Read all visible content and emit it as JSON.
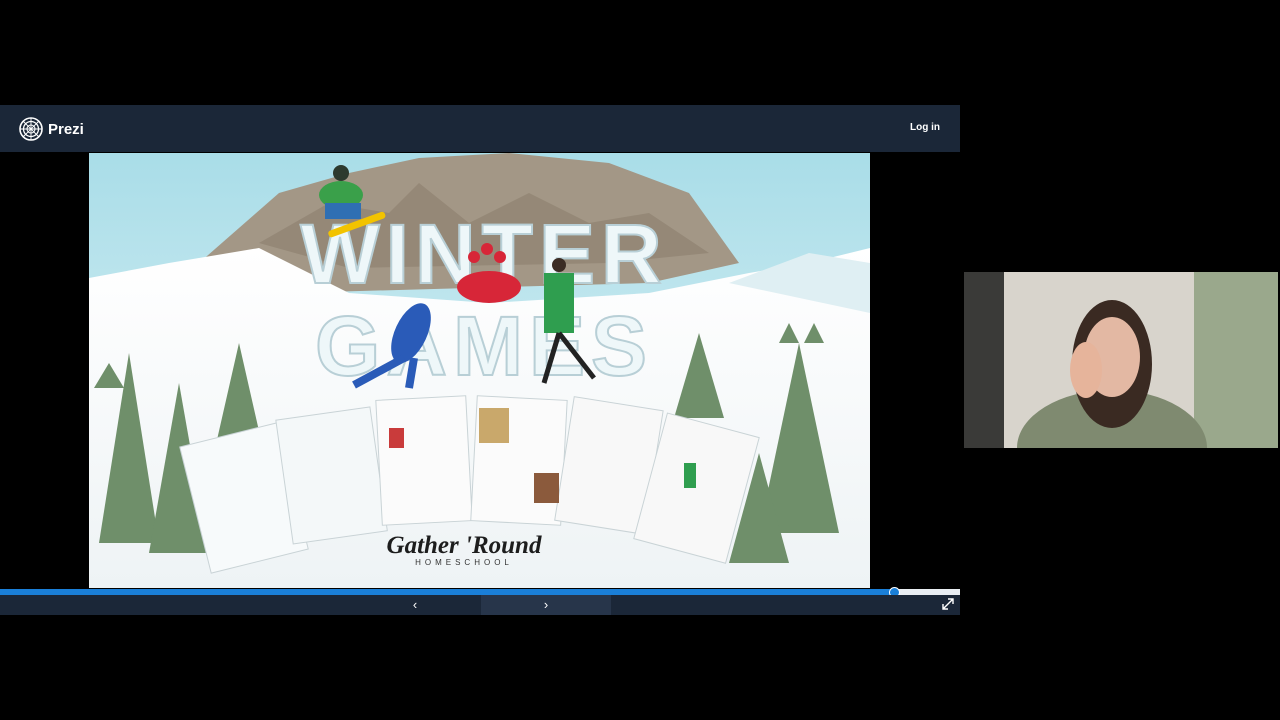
{
  "app": {
    "name": "Prezi",
    "login_label": "Log in"
  },
  "slide": {
    "title_line1": "WINTER",
    "title_line2": "GAMES",
    "brand_line1": "Gather 'Round",
    "brand_line2": "HOMESCHOOL"
  },
  "progress": {
    "fraction": 0.93
  },
  "nav": {
    "prev_symbol": "‹",
    "next_symbol": "›"
  },
  "icons": {
    "logo": "prezi-logo-icon",
    "fullscreen": "fullscreen-icon"
  },
  "colors": {
    "topbar": "#1b2738",
    "progress": "#1a7fd8",
    "sky": "#bfe6ef"
  }
}
